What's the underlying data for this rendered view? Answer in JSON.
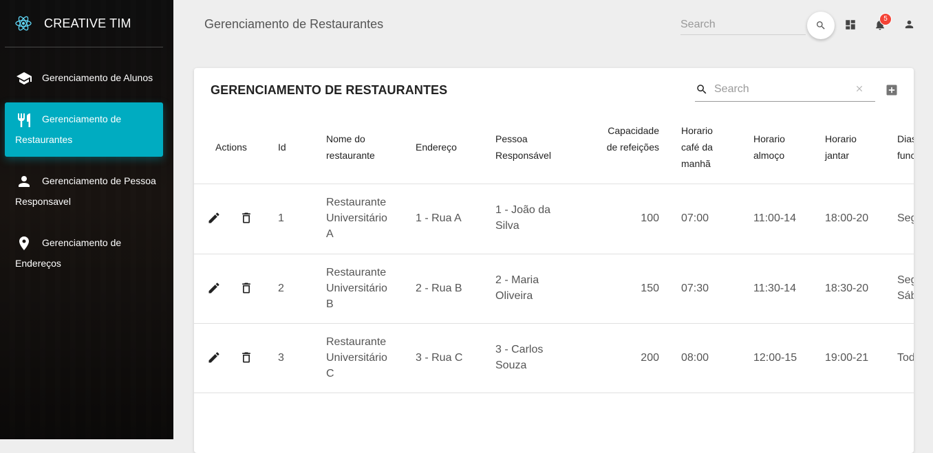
{
  "sidebar": {
    "logo_text": "CREATIVE TIM",
    "items": [
      {
        "label": "Gerenciamento de Alunos",
        "icon": "school-icon"
      },
      {
        "label": "Gerenciamento de Restaurantes",
        "icon": "restaurant-icon"
      },
      {
        "label": "Gerenciamento de Pessoa Responsavel",
        "icon": "person-icon"
      },
      {
        "label": "Gerenciamento de Endereços",
        "icon": "location-pin-icon"
      }
    ],
    "active_index": 1,
    "active_color": "#00acc1"
  },
  "topbar": {
    "title": "Gerenciamento de Restaurantes",
    "search_placeholder": "Search",
    "notification_count": "5",
    "badge_color": "#f44336"
  },
  "card": {
    "title": "GERENCIAMENTO DE RESTAURANTES",
    "search_placeholder": "Search",
    "columns": [
      "Actions",
      "Id",
      "Nome do restaurante",
      "Endereço",
      "Pessoa Responsável",
      "Capacidade de refeições",
      "Horario café da manhã",
      "Horario almoço",
      "Horario jantar",
      "Dias funcionamento"
    ],
    "rows": [
      {
        "id": "1",
        "nome": "Restaurante Universitário A",
        "endereco": "1 - Rua A",
        "pessoa": "1 - João da Silva",
        "capacidade": "100",
        "cafe": "07:00",
        "almoco": "11:00-14",
        "jantar": "18:00-20",
        "dias": "Seg"
      },
      {
        "id": "2",
        "nome": "Restaurante Universitário B",
        "endereco": "2 - Rua B",
        "pessoa": "2 - Maria Oliveira",
        "capacidade": "150",
        "cafe": "07:30",
        "almoco": "11:30-14",
        "jantar": "18:30-20",
        "dias": "Seg Sáb"
      },
      {
        "id": "3",
        "nome": "Restaurante Universitário C",
        "endereco": "3 - Rua C",
        "pessoa": "3 - Carlos Souza",
        "capacidade": "200",
        "cafe": "08:00",
        "almoco": "12:00-15",
        "jantar": "19:00-21",
        "dias": "Tod"
      }
    ]
  }
}
